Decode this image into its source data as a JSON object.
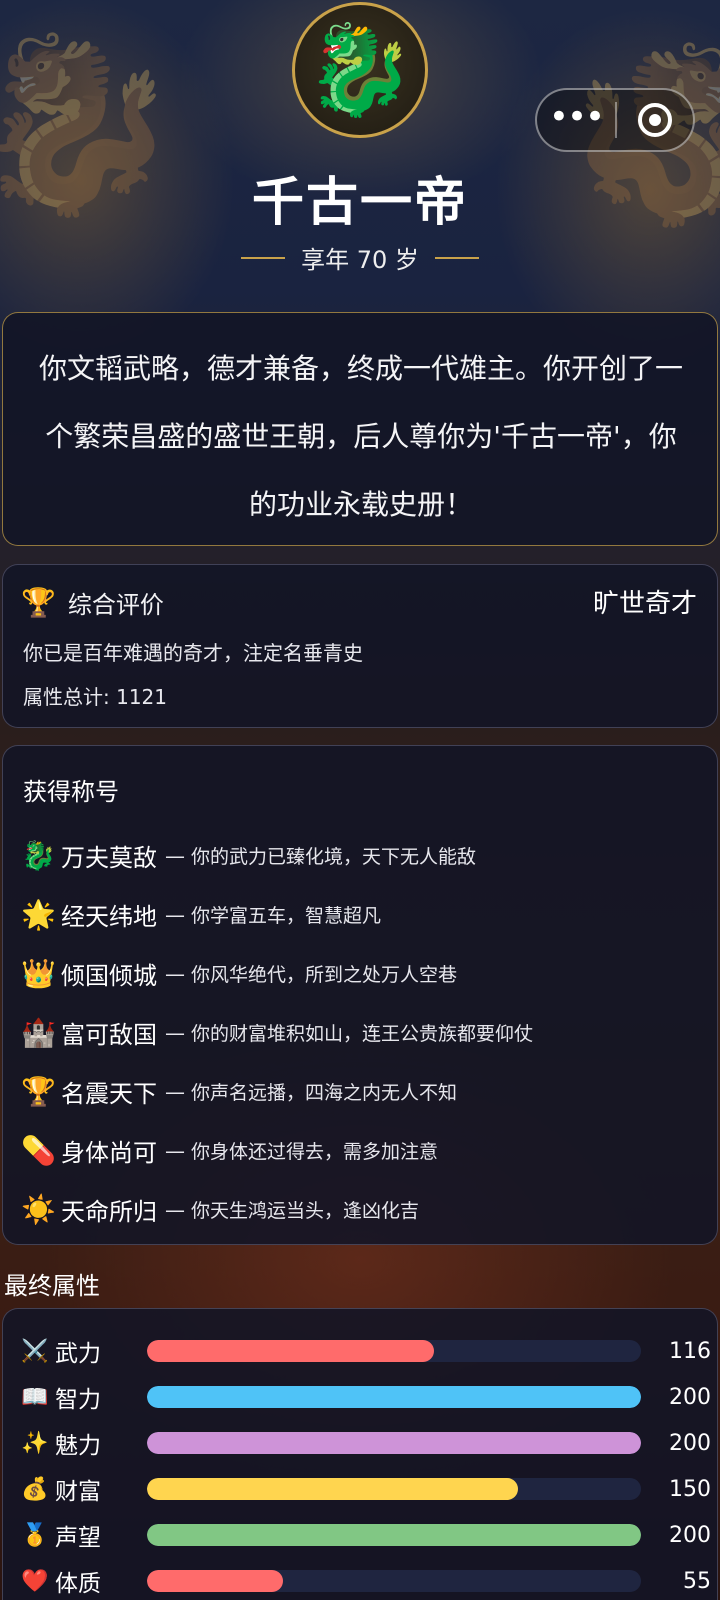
{
  "header": {
    "avatar_emoji": "🐉",
    "title": "千古一帝",
    "age_label": "享年 70 岁"
  },
  "capsule": {
    "more_label": "•••"
  },
  "story": {
    "text": "你文韬武略，德才兼备，终成一代雄主。你开创了一个繁荣昌盛的盛世王朝，后人尊你为'千古一帝'，你的功业永载史册！"
  },
  "evaluation": {
    "icon": "🏆",
    "title": "综合评价",
    "level": "旷世奇才",
    "description": "你已是百年难遇的奇才，注定名垂青史",
    "total": "属性总计: 1121"
  },
  "titles": {
    "heading": "获得称号",
    "items": [
      {
        "icon": "🐉",
        "name": "万夫莫敌",
        "desc": "你的武力已臻化境，天下无人能敌"
      },
      {
        "icon": "🌟",
        "name": "经天纬地",
        "desc": "你学富五车，智慧超凡"
      },
      {
        "icon": "👑",
        "name": "倾国倾城",
        "desc": "你风华绝代，所到之处万人空巷"
      },
      {
        "icon": "🏰",
        "name": "富可敌国",
        "desc": "你的财富堆积如山，连王公贵族都要仰仗"
      },
      {
        "icon": "🏆",
        "name": "名震天下",
        "desc": "你声名远播，四海之内无人不知"
      },
      {
        "icon": "💊",
        "name": "身体尚可",
        "desc": "你身体还过得去，需多加注意"
      },
      {
        "icon": "☀️",
        "name": "天命所归",
        "desc": "你天生鸿运当头，逢凶化吉"
      }
    ]
  },
  "attributes": {
    "heading": "最终属性",
    "max": 200,
    "items": [
      {
        "icon": "⚔️",
        "name": "武力",
        "value": 116,
        "color": "#ff6b6b"
      },
      {
        "icon": "📖",
        "name": "智力",
        "value": 200,
        "color": "#4fc3f7"
      },
      {
        "icon": "✨",
        "name": "魅力",
        "value": 200,
        "color": "#ce93d8"
      },
      {
        "icon": "💰",
        "name": "财富",
        "value": 150,
        "color": "#ffd54f"
      },
      {
        "icon": "🥇",
        "name": "声望",
        "value": 200,
        "color": "#81c784"
      },
      {
        "icon": "❤️",
        "name": "体质",
        "value": 55,
        "color": "#ff6b6b"
      }
    ]
  }
}
